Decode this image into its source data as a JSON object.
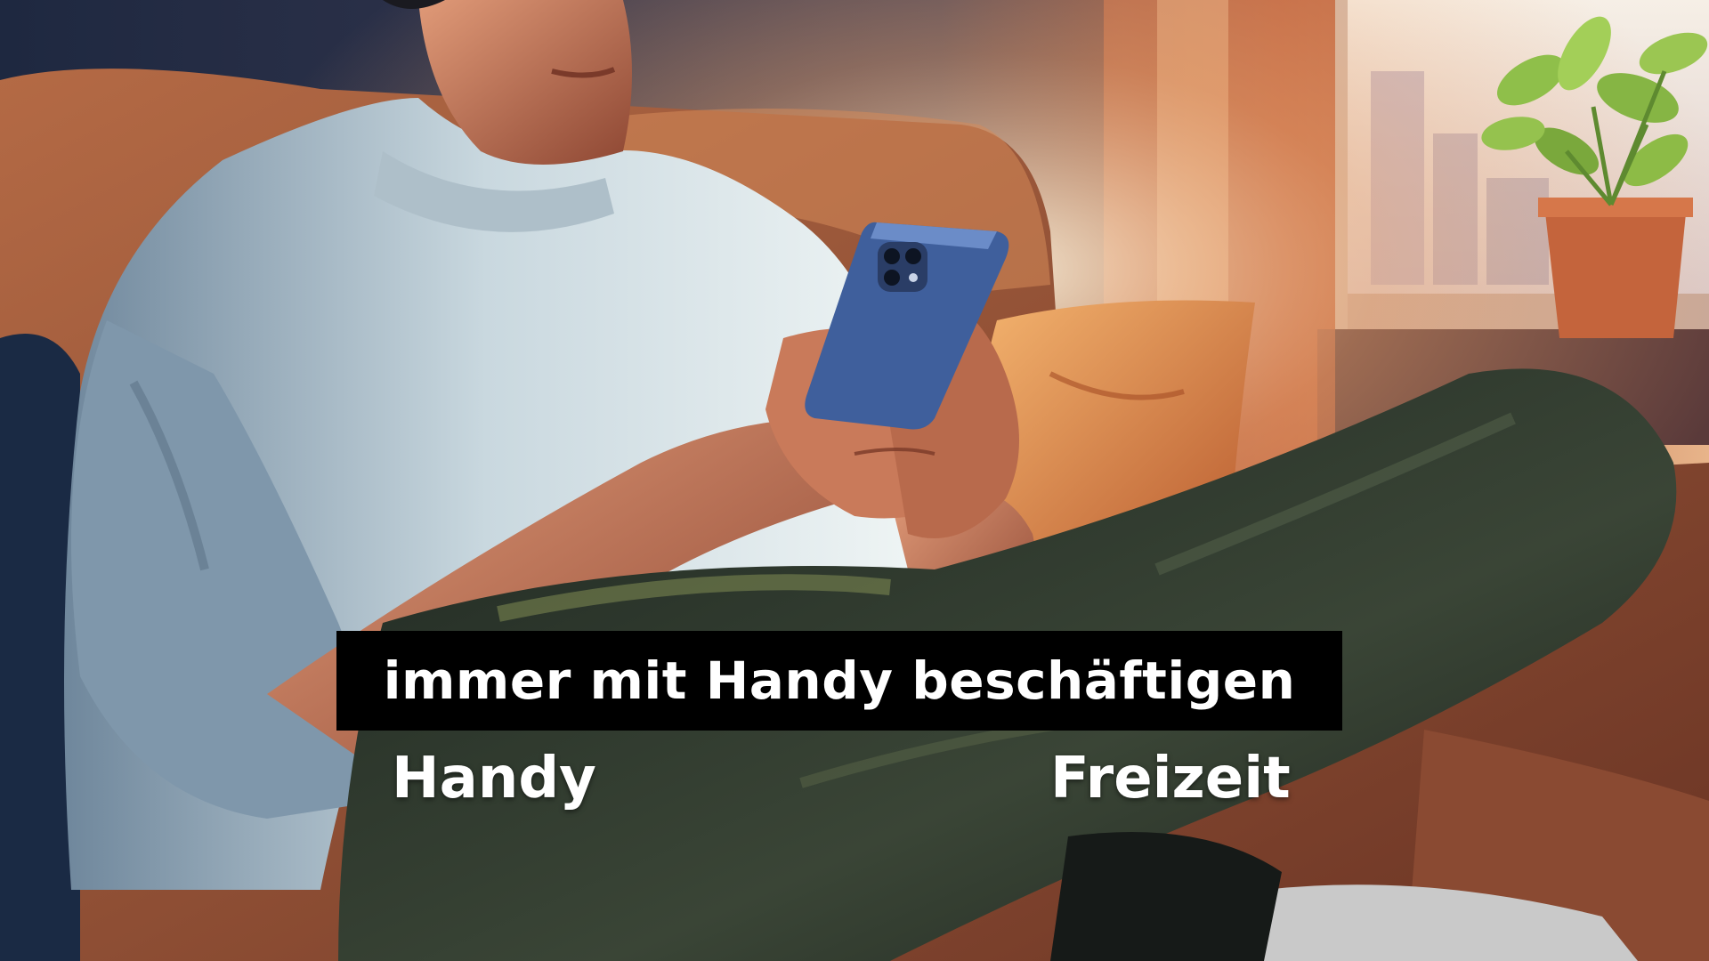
{
  "caption": {
    "text": "immer mit Handy beschäftigen",
    "background_color": "#000000",
    "text_color": "#ffffff"
  },
  "labels": {
    "left": "Handy",
    "right": "Freizeit"
  },
  "scene": {
    "description_icon": "man-on-sofa-with-phone-illustration",
    "palette": {
      "shirt": "#dfe8ec",
      "shirt_shadow": "#7e95a8",
      "skin": "#c9785a",
      "skin_shadow": "#8a4a36",
      "pants": "#2f3a30",
      "pants_light": "#6d7a54",
      "sofa": "#a65a3a",
      "sofa_dark": "#5c2f22",
      "pillow": "#e49a55",
      "window_light": "#f7e3c2",
      "wall": "#2c3650",
      "plant": "#8fbf4a",
      "pot": "#c4643c",
      "phone": "#3f5f9c"
    }
  }
}
